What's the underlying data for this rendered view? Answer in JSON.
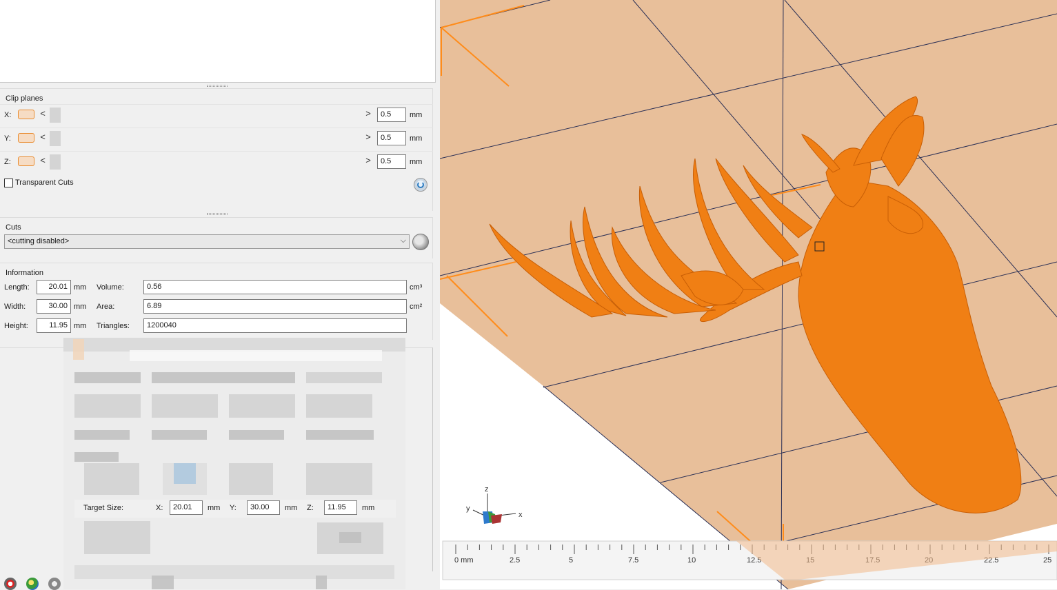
{
  "clip_planes": {
    "title": "Clip planes",
    "rows": [
      {
        "axis": "X:",
        "value": "0.5",
        "unit": "mm"
      },
      {
        "axis": "Y:",
        "value": "0.5",
        "unit": "mm"
      },
      {
        "axis": "Z:",
        "value": "0.5",
        "unit": "mm"
      }
    ],
    "left_arrow": "<",
    "right_arrow": ">",
    "transparent_cuts_label": "Transparent Cuts",
    "transparent_cuts_checked": false,
    "reset_icon": "reset-icon"
  },
  "cuts": {
    "title": "Cuts",
    "selected": "<cutting disabled>",
    "chevron": "⌵"
  },
  "information": {
    "title": "Information",
    "length_label": "Length:",
    "length": "20.01",
    "length_unit": "mm",
    "width_label": "Width:",
    "width": "30.00",
    "width_unit": "mm",
    "height_label": "Height:",
    "height": "11.95",
    "height_unit": "mm",
    "volume_label": "Volume:",
    "volume": "0.56",
    "volume_unit": "cm³",
    "area_label": "Area:",
    "area": "6.89",
    "area_unit": "cm²",
    "triangles_label": "Triangles:",
    "triangles": "1200040"
  },
  "scale_dialog": {
    "target_size_label": "Target Size:",
    "x_label": "X:",
    "x_value": "20.01",
    "x_unit": "mm",
    "y_label": "Y:",
    "y_value": "30.00",
    "y_unit": "mm",
    "z_label": "Z:",
    "z_value": "11.95",
    "z_unit": "mm"
  },
  "viewport": {
    "axis_labels": {
      "x": "x",
      "y": "y",
      "z": "z"
    },
    "ruler_labels": [
      "0 mm",
      "2.5",
      "5",
      "7.5",
      "10",
      "12.5",
      "15",
      "17.5",
      "20",
      "22.5",
      "25"
    ],
    "colors": {
      "bed": "#e8bf9a",
      "model": "#f07f14",
      "grid_line": "#2a2f55",
      "accent": "#ff8c1a"
    }
  },
  "toolbar": {
    "icons": [
      "settings-icon",
      "magic-icon",
      "repair-icon"
    ]
  }
}
